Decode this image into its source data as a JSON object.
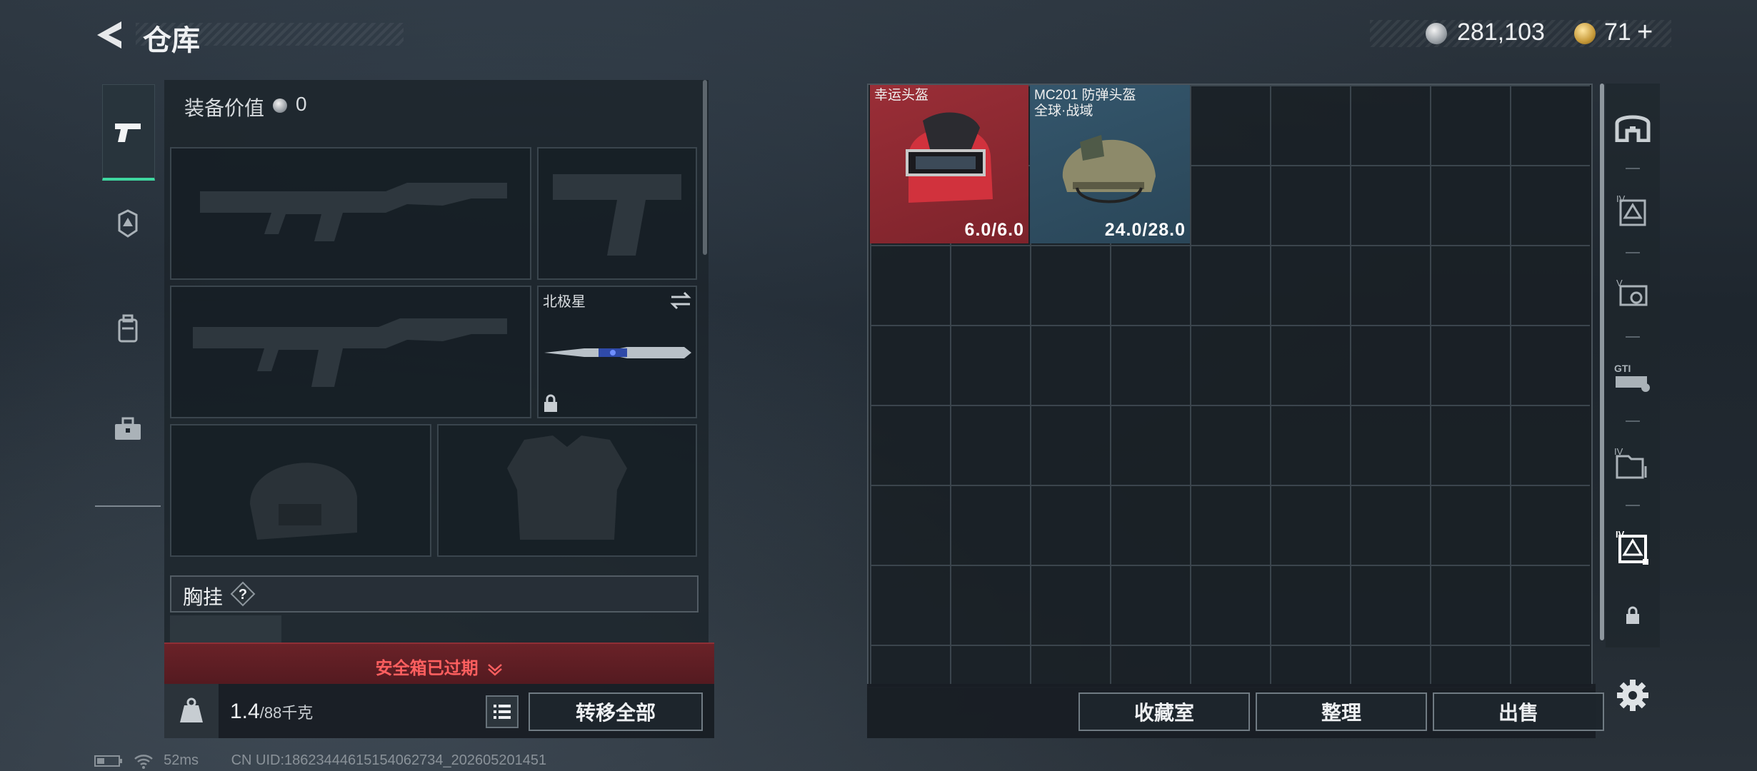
{
  "header": {
    "title": "仓库",
    "back_icon": "back-arrow-icon",
    "currency": {
      "silver_amount": "281,103",
      "silver_icon": "silver-coin-icon",
      "gold_amount": "71",
      "gold_icon": "gold-coin-icon",
      "add_symbol": "+"
    }
  },
  "left_tabs": [
    {
      "icon": "pistol-icon",
      "active": true
    },
    {
      "icon": "helmet-armor-icon",
      "active": false
    },
    {
      "icon": "backpack-icon",
      "active": false
    },
    {
      "icon": "toolbox-icon",
      "active": false
    }
  ],
  "equipment": {
    "value_label": "装备价值",
    "value_amount": "0",
    "slots": {
      "primary_weapon": "rifle-silhouette-icon",
      "pistol": "pistol-silhouette-icon",
      "secondary_weapon": "rifle-silhouette-icon",
      "melee_name": "北极星",
      "melee_swap_icon": "swap-arrows-icon",
      "melee_lock_icon": "lock-icon",
      "helmet": "helmet-silhouette-icon",
      "armor": "armor-silhouette-icon"
    },
    "chest_label": "胸挂",
    "chest_help": "?",
    "safe_box_status": "安全箱已过期",
    "weight_current": "1.4",
    "weight_max": "/88千克",
    "transfer_all": "转移全部"
  },
  "storage": {
    "items": [
      {
        "name": "幸运头盔",
        "durability": "6.0/6.0",
        "color": "#8c2a33"
      },
      {
        "name_line1": "MC201 防弹头盔",
        "name_line2": "全球·战域",
        "durability": "24.0/28.0",
        "color": "#2f4f63"
      }
    ],
    "buttons": {
      "collection": "收藏室",
      "sort": "整理",
      "sell": "出售"
    }
  },
  "side_filters": [
    {
      "icon": "all-items-icon",
      "label": ""
    },
    {
      "icon": "helmet-filter-icon",
      "label": "IV"
    },
    {
      "icon": "armor-filter-icon",
      "label": "V"
    },
    {
      "icon": "gti-filter-icon",
      "label": "GTI"
    },
    {
      "icon": "backpack-filter-icon",
      "label": "IV"
    },
    {
      "icon": "helmet-filter-active-icon",
      "label": "IV"
    },
    {
      "icon": "lock-icon",
      "label": ""
    }
  ],
  "status_bar": {
    "ping": "52ms",
    "uid": "CN UID:1862344461515406273‌4_202605201451"
  }
}
